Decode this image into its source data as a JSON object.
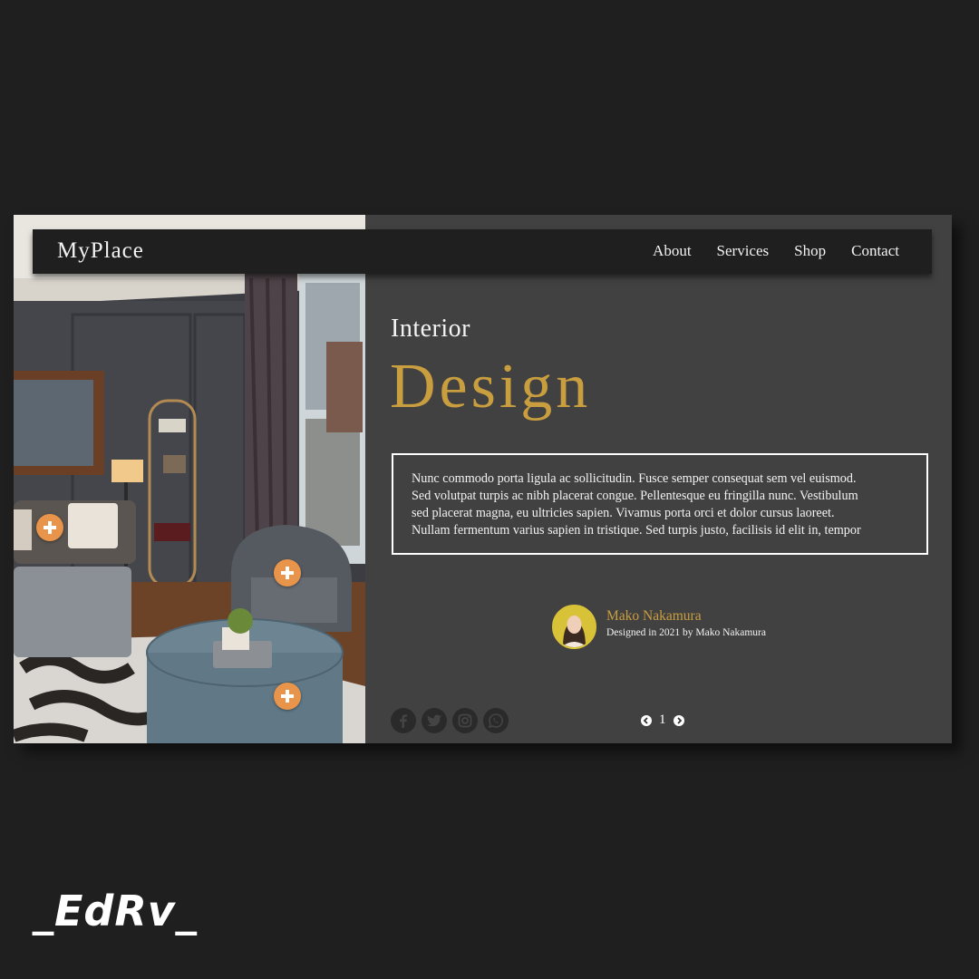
{
  "brand": {
    "logo": "MyPlace"
  },
  "nav": {
    "items": [
      "About",
      "Services",
      "Shop",
      "Contact"
    ]
  },
  "hero": {
    "subtitle": "Interior",
    "headline": "Design",
    "body": "Nunc commodo porta ligula ac sollicitudin. Fusce semper consequat sem vel euismod.\nSed volutpat turpis ac nibh placerat congue. Pellentesque eu fringilla nunc. Vestibulum\nsed placerat magna, eu ultricies sapien. Vivamus porta orci et dolor cursus laoreet.\nNullam fermentum varius sapien in tristique. Sed turpis justo, facilisis id elit in, tempor"
  },
  "author": {
    "name": "Mako Nakamura",
    "note": "Designed in 2021 by Mako Nakamura"
  },
  "social": {
    "icons": [
      "facebook-icon",
      "twitter-icon",
      "instagram-icon",
      "whatsapp-icon"
    ]
  },
  "pagination": {
    "current": "1"
  },
  "watermark": "_EdRv_",
  "colors": {
    "accent": "#c99e3f",
    "panel": "#424141",
    "background": "#201f20",
    "hotspot": "#e8944a"
  }
}
